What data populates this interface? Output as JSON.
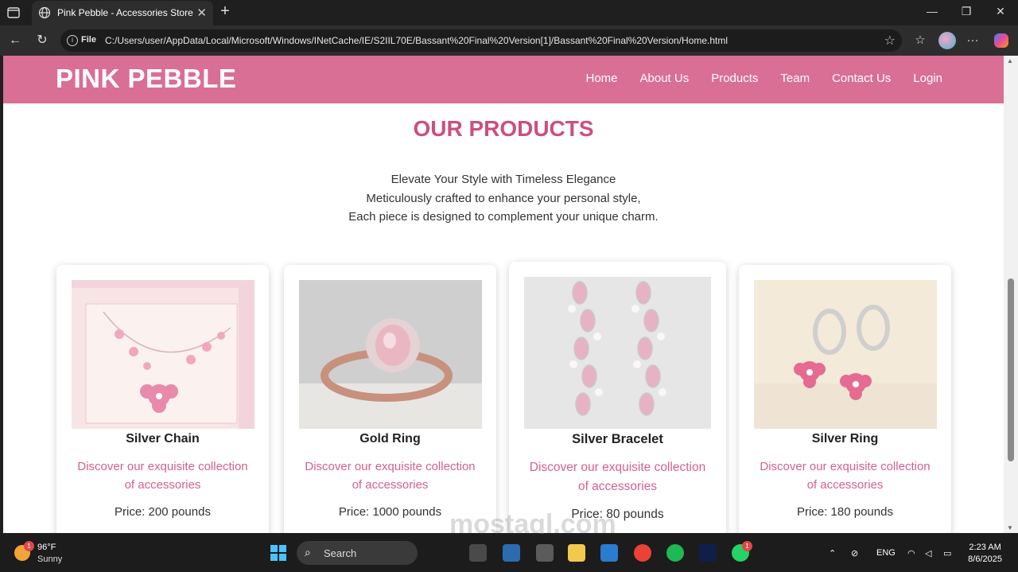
{
  "browser": {
    "tab_title": "Pink Pebble - Accessories Store",
    "address_scheme": "File",
    "url": "C:/Users/user/AppData/Local/Microsoft/Windows/INetCache/IE/S2IIL70E/Bassant%20Final%20Version[1]/Bassant%20Final%20Version/Home.html"
  },
  "site": {
    "brand": "PINK PEBBLE",
    "nav": [
      "Home",
      "About Us",
      "Products",
      "Team",
      "Contact Us",
      "Login"
    ]
  },
  "products_section": {
    "title": "OUR PRODUCTS",
    "tagline": [
      "Elevate Your Style with Timeless Elegance",
      "Meticulously crafted to enhance your personal style,",
      "Each piece is designed to complement your unique charm."
    ],
    "items": [
      {
        "name": "Silver Chain",
        "desc_line1": "Discover our exquisite collection",
        "desc_line2": "of accessories",
        "price": "Price: 200 pounds"
      },
      {
        "name": "Gold Ring",
        "desc_line1": "Discover our exquisite collection",
        "desc_line2": "of accessories",
        "price": "Price: 1000 pounds"
      },
      {
        "name": "Silver Bracelet",
        "desc_line1": "Discover our exquisite collection",
        "desc_line2": "of accessories",
        "price": "Price: 80 pounds"
      },
      {
        "name": "Silver Ring",
        "desc_line1": "Discover our exquisite collection",
        "desc_line2": "of accessories",
        "price": "Price: 180 pounds"
      }
    ]
  },
  "watermark": "mostaql.com",
  "taskbar": {
    "weather_temp": "96°F",
    "weather_cond": "Sunny",
    "weather_badge": "1",
    "search_label": "Search",
    "whatsapp_badge": "1",
    "lang": "ENG",
    "time": "2:23 AM",
    "date": "8/6/2025"
  },
  "colors": {
    "brand_pink": "#d96f95",
    "title_pink": "#cc4f80",
    "desc_pink": "#d5608e"
  }
}
